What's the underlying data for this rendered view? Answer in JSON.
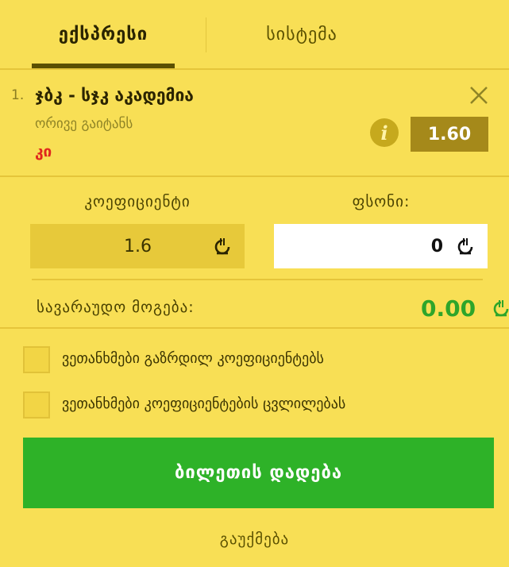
{
  "tabs": {
    "express": "ექსპრესი",
    "system": "სისტემა"
  },
  "bet": {
    "index": "1.",
    "title": "ჯბკ - სჯკ აკადემია",
    "market": "ორივე გაიტანს",
    "pick": "კი",
    "odds": "1.60"
  },
  "icons": {
    "close": "close-icon",
    "info": "info-icon",
    "currency": "lari-icon"
  },
  "fields": {
    "coef_label": "კოეფიციენტი",
    "coef_value": "1.6",
    "stake_label": "ფსონი:",
    "stake_value": "0"
  },
  "win": {
    "label": "სავარაუდო მოგება:",
    "value": "0.00"
  },
  "options": [
    {
      "label": "ვეთანხმები გაზრდილ კოეფიციენტებს"
    },
    {
      "label": "ვეთანხმები კოეფიციენტების ცვლილებას"
    }
  ],
  "actions": {
    "place": "ბილეთის დადება",
    "cancel": "გაუქმება"
  },
  "colors": {
    "background": "#f8df55",
    "primary": "#2eb228",
    "win": "#2ea52a",
    "pick": "#e0271d",
    "odds_badge": "#a5891a"
  }
}
